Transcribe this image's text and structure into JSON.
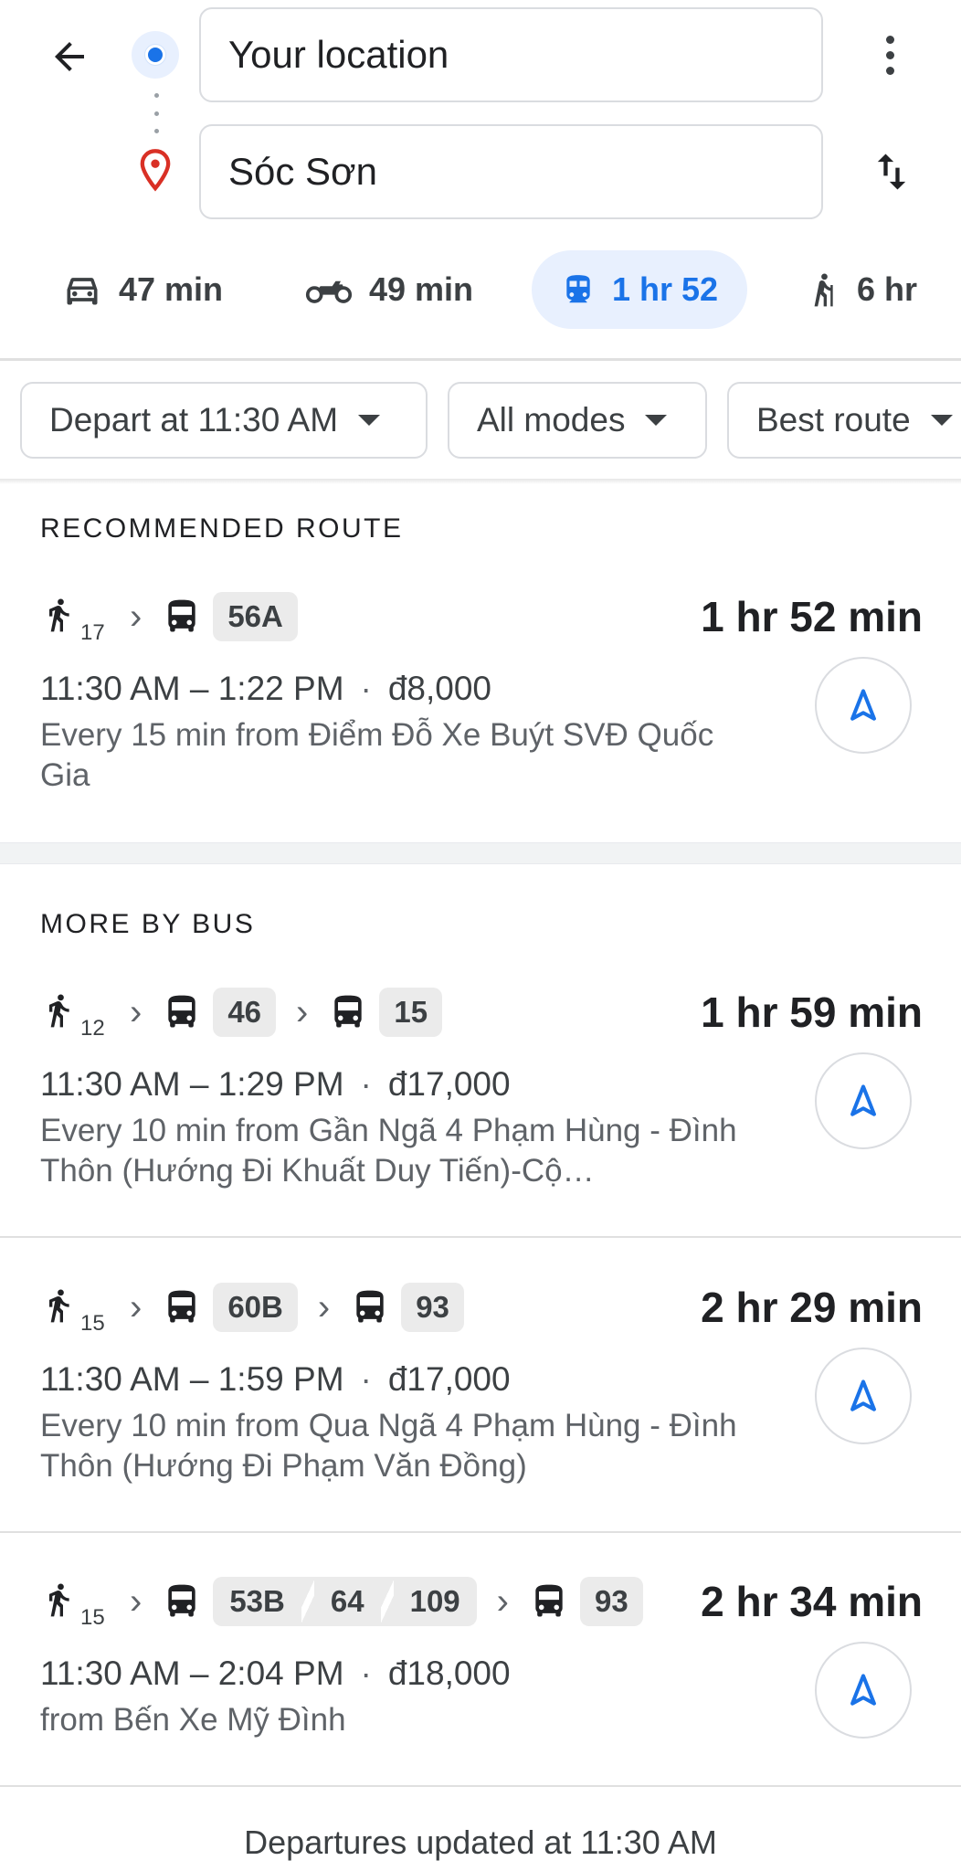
{
  "header": {
    "origin": "Your location",
    "destination": "Sóc Sơn",
    "icons": [
      "back-arrow-icon",
      "origin-dot-icon",
      "destination-pin-icon",
      "more-vert-icon",
      "swap-icon"
    ]
  },
  "modes": [
    {
      "icon": "car-icon",
      "label": "47 min"
    },
    {
      "icon": "motorcycle-icon",
      "label": "49 min"
    },
    {
      "icon": "transit-icon",
      "label": "1 hr 52",
      "selected": true
    },
    {
      "icon": "walk-icon",
      "label": "6 hr"
    }
  ],
  "filters": {
    "depart": "Depart at 11:30 AM",
    "modes": "All modes",
    "route": "Best route"
  },
  "sections": {
    "recommended": "RECOMMENDED ROUTE",
    "more": "MORE BY BUS"
  },
  "routes": [
    {
      "walk": "17",
      "buses": [
        "56A"
      ],
      "duration": "1 hr 52 min",
      "times": "11:30 AM – 1:22 PM",
      "fare": "đ8,000",
      "freq": "Every 15 min from Điểm Đỗ Xe Buýt SVĐ Quốc Gia"
    },
    {
      "walk": "12",
      "buses": [
        "46",
        "15"
      ],
      "duration": "1 hr 59 min",
      "times": "11:30 AM – 1:29 PM",
      "fare": "đ17,000",
      "freq": "Every 10 min from Gần Ngã 4 Phạm Hùng - Đình Thôn (Hướng Đi Khuất Duy Tiến)-Cộ…"
    },
    {
      "walk": "15",
      "buses": [
        "60B",
        "93"
      ],
      "duration": "2 hr 29 min",
      "times": "11:30 AM – 1:59 PM",
      "fare": "đ17,000",
      "freq": "Every 10 min from Qua Ngã 4 Phạm Hùng - Đình Thôn (Hướng Đi Phạm Văn Đồng)"
    },
    {
      "walk": "15",
      "buses": [
        "53B",
        "64",
        "109",
        "93"
      ],
      "duration": "2 hr 34 min",
      "times": "11:30 AM – 2:04 PM",
      "fare": "đ18,000",
      "freq": "from Bến Xe Mỹ Đình"
    }
  ],
  "footer": "Departures updated at 11:30 AM",
  "colors": {
    "accent": "#1a73e8",
    "accent_bg": "#e8f0fe",
    "pin": "#d93025",
    "text": "#202124",
    "muted": "#5f6368"
  }
}
